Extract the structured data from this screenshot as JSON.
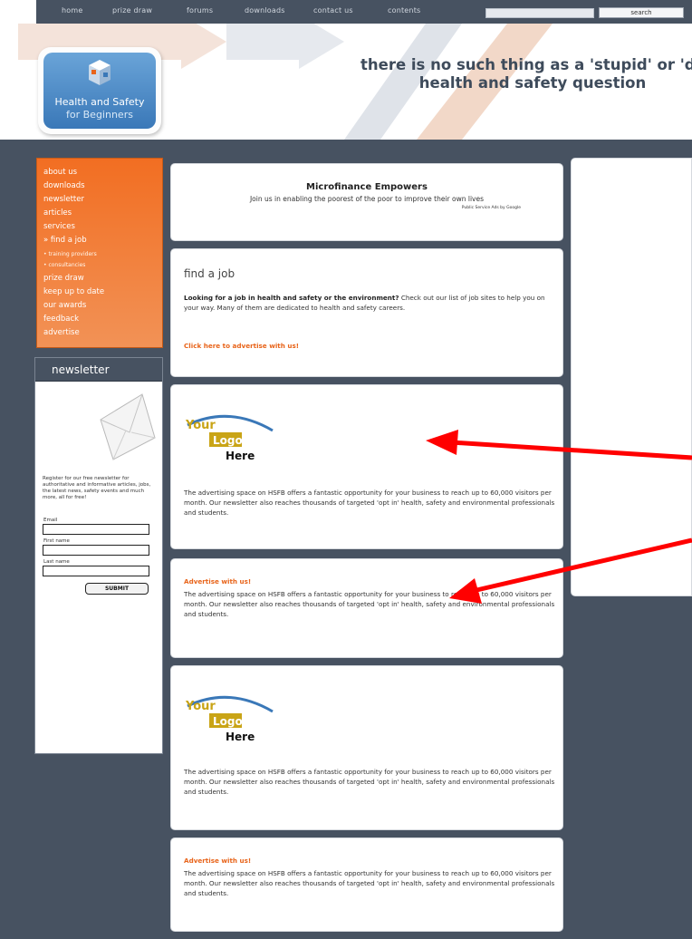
{
  "topnav": {
    "items": [
      "home",
      "prize draw",
      "forums",
      "downloads",
      "contact us",
      "contents"
    ],
    "search_placeholder": "",
    "go_label": "search"
  },
  "header": {
    "logo_title": "Health and Safety",
    "logo_subtitle": "for Beginners",
    "tagline_1": "there is no such thing as a 'stupid' or 'daft'",
    "tagline_2": "health and safety question"
  },
  "leftnav": {
    "items": [
      "about us",
      "downloads",
      "newsletter",
      "articles",
      "services",
      "» find a job",
      "• training providers",
      "• consultancies",
      "prize draw",
      "keep up to date",
      "our awards",
      "feedback",
      "advertise"
    ]
  },
  "newsletter": {
    "heading": "newsletter",
    "description": "Register for our free newsletter for authoritative and informative articles, jobs, the latest news, safety events and much more, all for free!",
    "email_label": "Email",
    "firstname_label": "First name",
    "lastname_label": "Last name",
    "submit_label": "SUBMIT"
  },
  "sponsor_ad": {
    "title": "Microfinance Empowers",
    "line": "Join us in enabling the poorest of the poor to improve their own lives",
    "by": "Public Service Ads by Google"
  },
  "job": {
    "heading": "find a job",
    "text_bold": "Looking for a job in health and safety or the environment?",
    "text_rest": " Check out our list of job sites to help you on your way. Many of them are dedicated to health and safety careers.",
    "cta": "Click here to advertise with us!"
  },
  "ads": {
    "logo_text_1": "Your",
    "logo_text_2": "Logo",
    "logo_text_3": "Here",
    "body": "The advertising space on HSFB offers a fantastic opportunity for your business to reach up to 60,000 visitors per month. Our newsletter also reaches thousands of targeted 'opt in' health, safety and environmental professionals and students.",
    "advertise_heading": "Advertise with us!"
  },
  "colors": {
    "navy": "#475261",
    "orange": "#f26e22",
    "arrow_red": "#ff0000"
  }
}
